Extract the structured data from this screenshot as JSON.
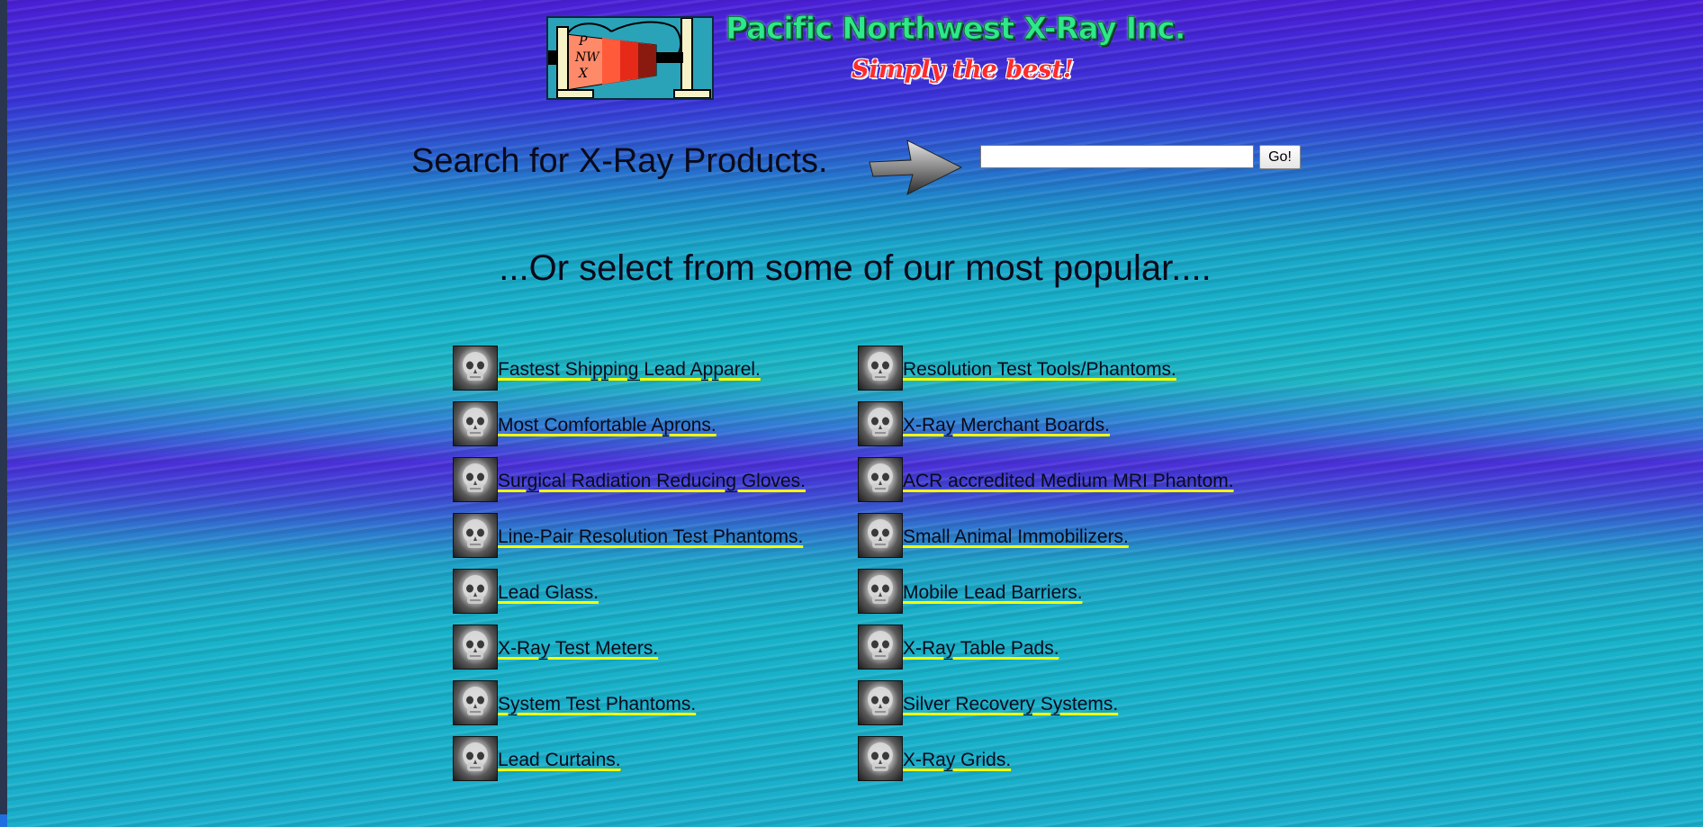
{
  "header": {
    "brand_title": "Pacific Northwest X-Ray Inc.",
    "tagline": "Simply the best!",
    "logo_letters": [
      "P",
      "NW",
      "X"
    ]
  },
  "search": {
    "label": "Search for X-Ray Products.",
    "input_value": "",
    "button_label": "Go!"
  },
  "popular": {
    "heading": "...Or select from some of our most popular...."
  },
  "products_left": [
    "Fastest Shipping Lead Apparel.",
    "Most Comfortable Aprons.",
    "Surgical Radiation Reducing Gloves.",
    "Line-Pair Resolution Test Phantoms.",
    "Lead Glass.",
    "X-Ray Test Meters.",
    "System Test Phantoms.",
    "Lead Curtains."
  ],
  "products_right": [
    "Resolution Test Tools/Phantoms.",
    "X-Ray Merchant Boards.",
    "ACR accredited Medium MRI Phantom.",
    "Small Animal Immobilizers.",
    "Mobile Lead Barriers.",
    "X-Ray Table Pads.",
    "Silver Recovery Systems.",
    "X-Ray Grids."
  ],
  "colors": {
    "link_underline": "#f2ff00",
    "brand_green": "#2ee88a",
    "tagline_red": "#ff2b2b"
  },
  "icons": {
    "product_icon": "skull-xray-icon",
    "search_pointer": "arrow-right-icon"
  }
}
